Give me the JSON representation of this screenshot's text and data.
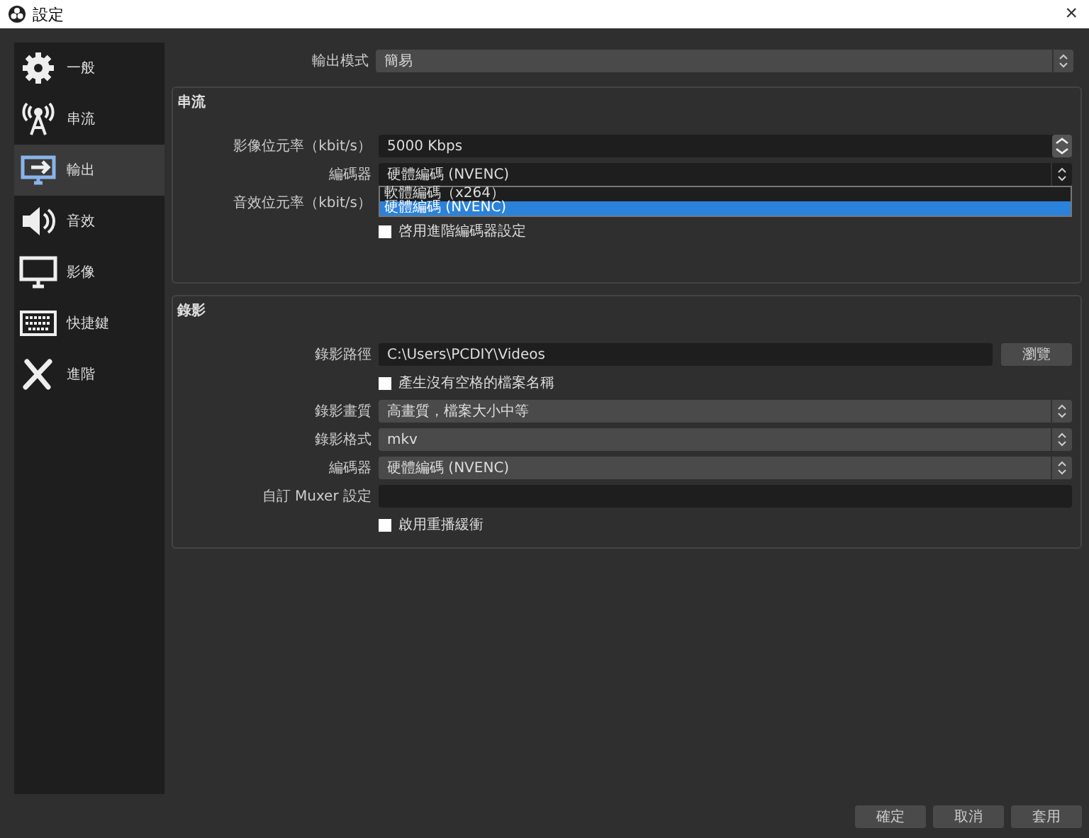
{
  "window": {
    "title": "設定",
    "close": "×"
  },
  "sidebar": {
    "items": [
      {
        "label": "一般",
        "selected": false
      },
      {
        "label": "串流",
        "selected": false
      },
      {
        "label": "輸出",
        "selected": true
      },
      {
        "label": "音效",
        "selected": false
      },
      {
        "label": "影像",
        "selected": false
      },
      {
        "label": "快捷鍵",
        "selected": false
      },
      {
        "label": "進階",
        "selected": false
      }
    ]
  },
  "output_mode": {
    "label": "輸出模式",
    "value": "簡易"
  },
  "groups": [
    {
      "title": "串流",
      "rows": [
        {
          "kind": "spin",
          "label": "影像位元率（kbit/s）",
          "value": "5000 Kbps"
        },
        {
          "kind": "select",
          "label": "編碼器",
          "value": "硬體編碼 (NVENC)",
          "options": [
            {
              "label": "軟體編碼（x264）",
              "selected": false
            },
            {
              "label": "硬體編碼 (NVENC)",
              "selected": true
            }
          ]
        },
        {
          "kind": "hidden",
          "label": "音效位元率（kbit/s）"
        },
        {
          "kind": "checkbox",
          "label": "啓用進階編碼器設定",
          "checked": false
        }
      ]
    },
    {
      "title": "錄影",
      "rows": [
        {
          "kind": "path",
          "label": "錄影路徑",
          "value": "C:\\Users\\PCDIY\\Videos",
          "button": "瀏覽"
        },
        {
          "kind": "checkbox",
          "label": "產生沒有空格的檔案名稱",
          "checked": false
        },
        {
          "kind": "select",
          "label": "錄影畫質",
          "value": "高畫質，檔案大小中等"
        },
        {
          "kind": "select",
          "label": "錄影格式",
          "value": "mkv"
        },
        {
          "kind": "select",
          "label": "編碼器",
          "value": "硬體編碼 (NVENC)"
        },
        {
          "kind": "text",
          "label": "自訂 Muxer 設定",
          "value": ""
        },
        {
          "kind": "checkbox",
          "label": "啟用重播緩衝",
          "checked": false
        }
      ]
    }
  ],
  "buttons": [
    "確定",
    "取消",
    "套用"
  ]
}
